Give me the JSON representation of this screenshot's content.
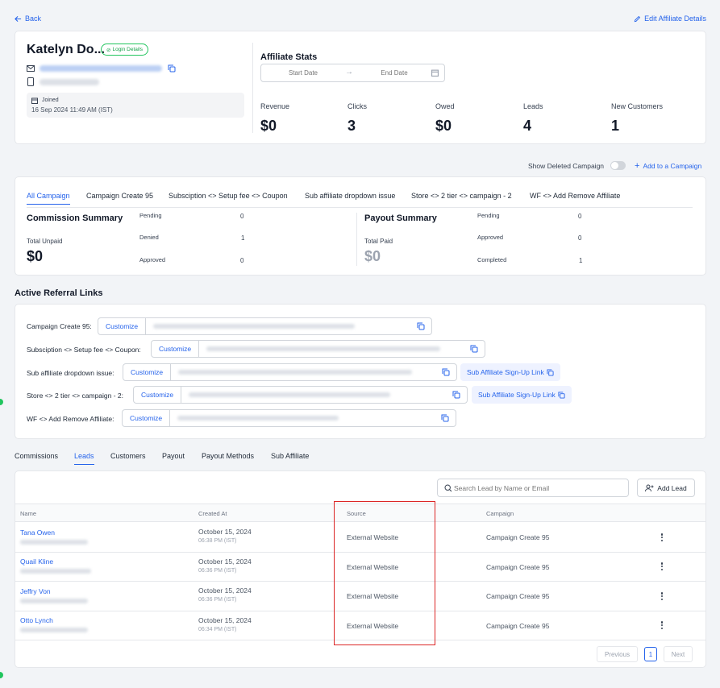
{
  "header": {
    "back_label": "Back",
    "edit_label": "Edit Affiliate Details"
  },
  "profile": {
    "name": "Katelyn Do...",
    "login_details_label": "Login Details",
    "joined_label": "Joined",
    "joined_value": "16 Sep 2024 11:49 AM (IST)"
  },
  "stats": {
    "title": "Affiliate Stats",
    "start_placeholder": "Start Date",
    "end_placeholder": "End Date",
    "items": [
      {
        "label": "Revenue",
        "value": "$0"
      },
      {
        "label": "Clicks",
        "value": "3"
      },
      {
        "label": "Owed",
        "value": "$0"
      },
      {
        "label": "Leads",
        "value": "4"
      },
      {
        "label": "New Customers",
        "value": "1"
      }
    ]
  },
  "campaign_bar": {
    "show_deleted_label": "Show Deleted Campaign",
    "add_label": "Add to a Campaign"
  },
  "campaign_tabs": [
    "All Campaign",
    "Campaign Create 95",
    "Subsciption <> Setup fee <> Coupon",
    "Sub affiliate dropdown issue",
    "Store <> 2 tier <> campaign - 2",
    "WF <> Add Remove Affiliate"
  ],
  "commission_summary": {
    "title": "Commission Summary",
    "total_label": "Total Unpaid",
    "total_value": "$0",
    "rows": [
      {
        "label": "Pending",
        "value": "0"
      },
      {
        "label": "Denied",
        "value": "1"
      },
      {
        "label": "Approved",
        "value": "0"
      }
    ]
  },
  "payout_summary": {
    "title": "Payout Summary",
    "total_label": "Total Paid",
    "total_value": "$0",
    "rows": [
      {
        "label": "Pending",
        "value": "0"
      },
      {
        "label": "Approved",
        "value": "0"
      },
      {
        "label": "Completed",
        "value": "1"
      }
    ]
  },
  "referral": {
    "title": "Active Referral Links",
    "customize_label": "Customize",
    "sub_affiliate_label": "Sub Affiliate Sign-Up Link",
    "rows": [
      {
        "label": "Campaign Create 95:"
      },
      {
        "label": "Subsciption <> Setup fee <> Coupon:"
      },
      {
        "label": "Sub affiliate dropdown issue:"
      },
      {
        "label": "Store <> 2 tier <> campaign - 2:"
      },
      {
        "label": "WF <> Add Remove Affiliate:"
      }
    ]
  },
  "section_tabs": [
    "Commissions",
    "Leads",
    "Customers",
    "Payout",
    "Payout Methods",
    "Sub Affiliate"
  ],
  "leads": {
    "search_placeholder": "Search Lead by Name or Email",
    "add_label": "Add Lead",
    "columns": [
      "Name",
      "Created At",
      "Source",
      "Campaign"
    ],
    "rows": [
      {
        "name": "Tana Owen",
        "date": "October 15, 2024",
        "time": "06:38 PM (IST)",
        "source": "External Website",
        "campaign": "Campaign Create 95"
      },
      {
        "name": "Quail Kline",
        "date": "October 15, 2024",
        "time": "06:36 PM (IST)",
        "source": "External Website",
        "campaign": "Campaign Create 95"
      },
      {
        "name": "Jeffry Von",
        "date": "October 15, 2024",
        "time": "06:36 PM (IST)",
        "source": "External Website",
        "campaign": "Campaign Create 95"
      },
      {
        "name": "Otto Lynch",
        "date": "October 15, 2024",
        "time": "06:34 PM (IST)",
        "source": "External Website",
        "campaign": "Campaign Create 95"
      }
    ],
    "pagination": {
      "previous": "Previous",
      "page": "1",
      "next": "Next"
    }
  },
  "colors": {
    "accent": "#2563eb",
    "highlight_box": "#dc2626",
    "badge_green": "#16a34a"
  }
}
